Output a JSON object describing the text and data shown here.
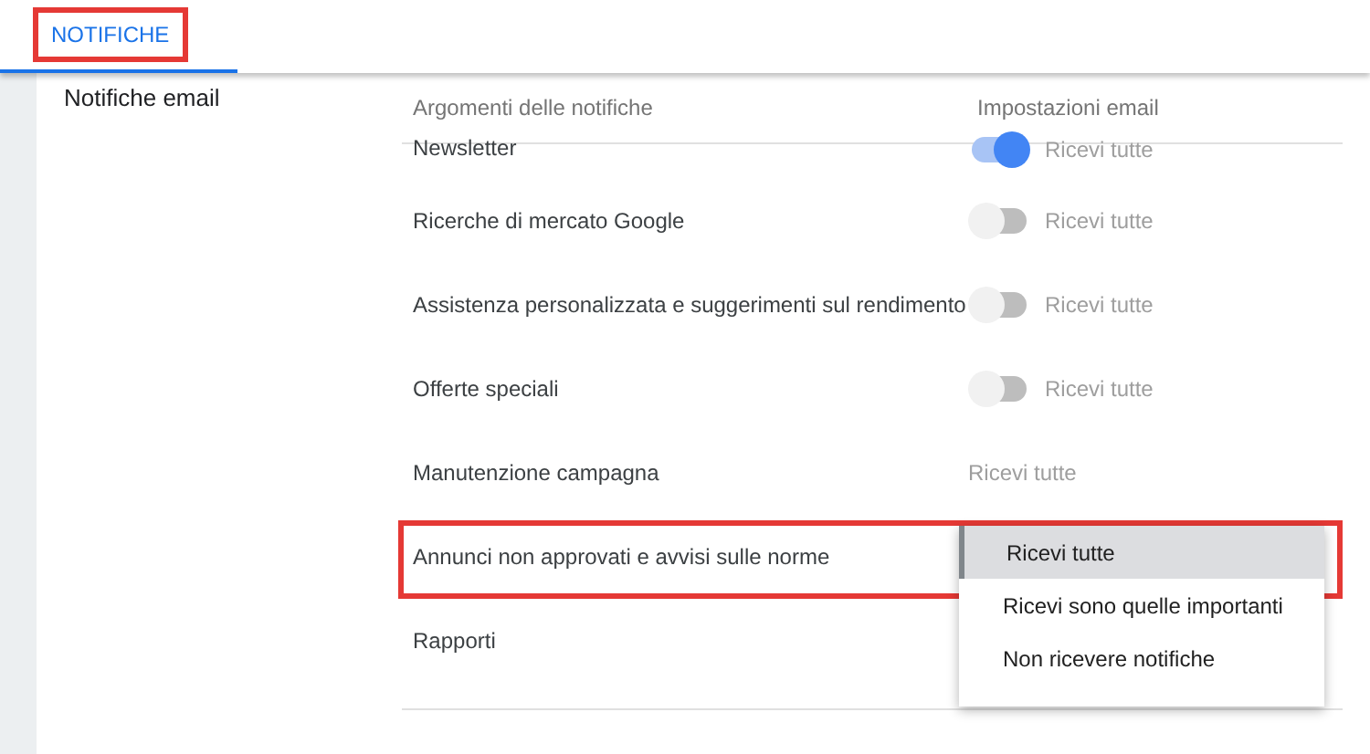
{
  "tab": {
    "label": "NOTIFICHE",
    "selected": true,
    "highlighted": true
  },
  "section_title": "Notifiche email",
  "table": {
    "columns": [
      "Argomenti delle notifiche",
      "Impostazioni email"
    ],
    "rows": [
      {
        "topic": "Newsletter",
        "kind": "toggle",
        "on": true,
        "value": "Ricevi tutte",
        "highlighted": false
      },
      {
        "topic": "Ricerche di mercato Google",
        "kind": "toggle",
        "on": false,
        "value": "Ricevi tutte",
        "highlighted": false
      },
      {
        "topic": "Assistenza personalizzata e suggerimenti sul rendimento",
        "kind": "toggle",
        "on": false,
        "value": "Ricevi tutte",
        "highlighted": false
      },
      {
        "topic": "Offerte speciali",
        "kind": "toggle",
        "on": false,
        "value": "Ricevi tutte",
        "highlighted": false
      },
      {
        "topic": "Manutenzione campagna",
        "kind": "text",
        "value": "Ricevi tutte",
        "highlighted": false
      },
      {
        "topic": "Annunci non approvati e avvisi sulle norme",
        "kind": "dropdown",
        "highlighted": true,
        "options": [
          {
            "label": "Ricevi tutte",
            "selected": true
          },
          {
            "label": "Ricevi sono quelle importanti",
            "selected": false
          },
          {
            "label": "Non ricevere notifiche",
            "selected": false
          }
        ]
      },
      {
        "topic": "Rapporti",
        "kind": "none",
        "highlighted": false
      }
    ]
  }
}
